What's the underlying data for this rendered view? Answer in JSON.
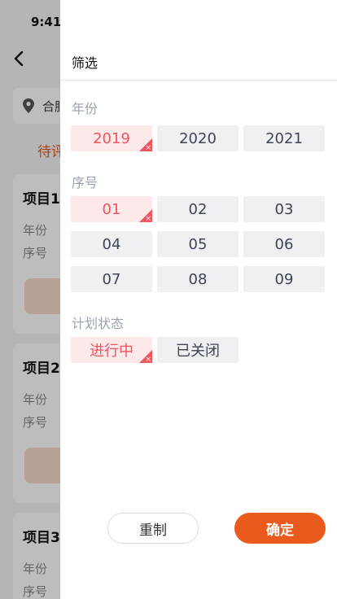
{
  "status": {
    "time": "9:41"
  },
  "background": {
    "search_city": "合肥",
    "tab": "待评",
    "cards": [
      {
        "title": "项目1",
        "line1": "年份",
        "line2": "序号"
      },
      {
        "title": "项目2",
        "line1": "年份",
        "line2": "序号"
      },
      {
        "title": "项目3",
        "line1": "年份",
        "line2": "序号"
      }
    ]
  },
  "drawer": {
    "title": "筛选",
    "sections": {
      "year": {
        "label": "年份",
        "options": [
          "2019",
          "2020",
          "2021"
        ],
        "selected": "2019"
      },
      "serial": {
        "label": "序号",
        "options": [
          "01",
          "02",
          "03",
          "04",
          "05",
          "06",
          "07",
          "08",
          "09"
        ],
        "selected": "01"
      },
      "plan_status": {
        "label": "计划状态",
        "options": [
          "进行中",
          "已关闭"
        ],
        "selected": "进行中"
      }
    },
    "buttons": {
      "reset": "重制",
      "confirm": "确定"
    },
    "selected_mark": "×"
  },
  "colors": {
    "accent": "#ea5a1c",
    "selected_text": "#f0545f",
    "selected_bg": "#fde9ea",
    "option_bg": "#eff0f2"
  }
}
